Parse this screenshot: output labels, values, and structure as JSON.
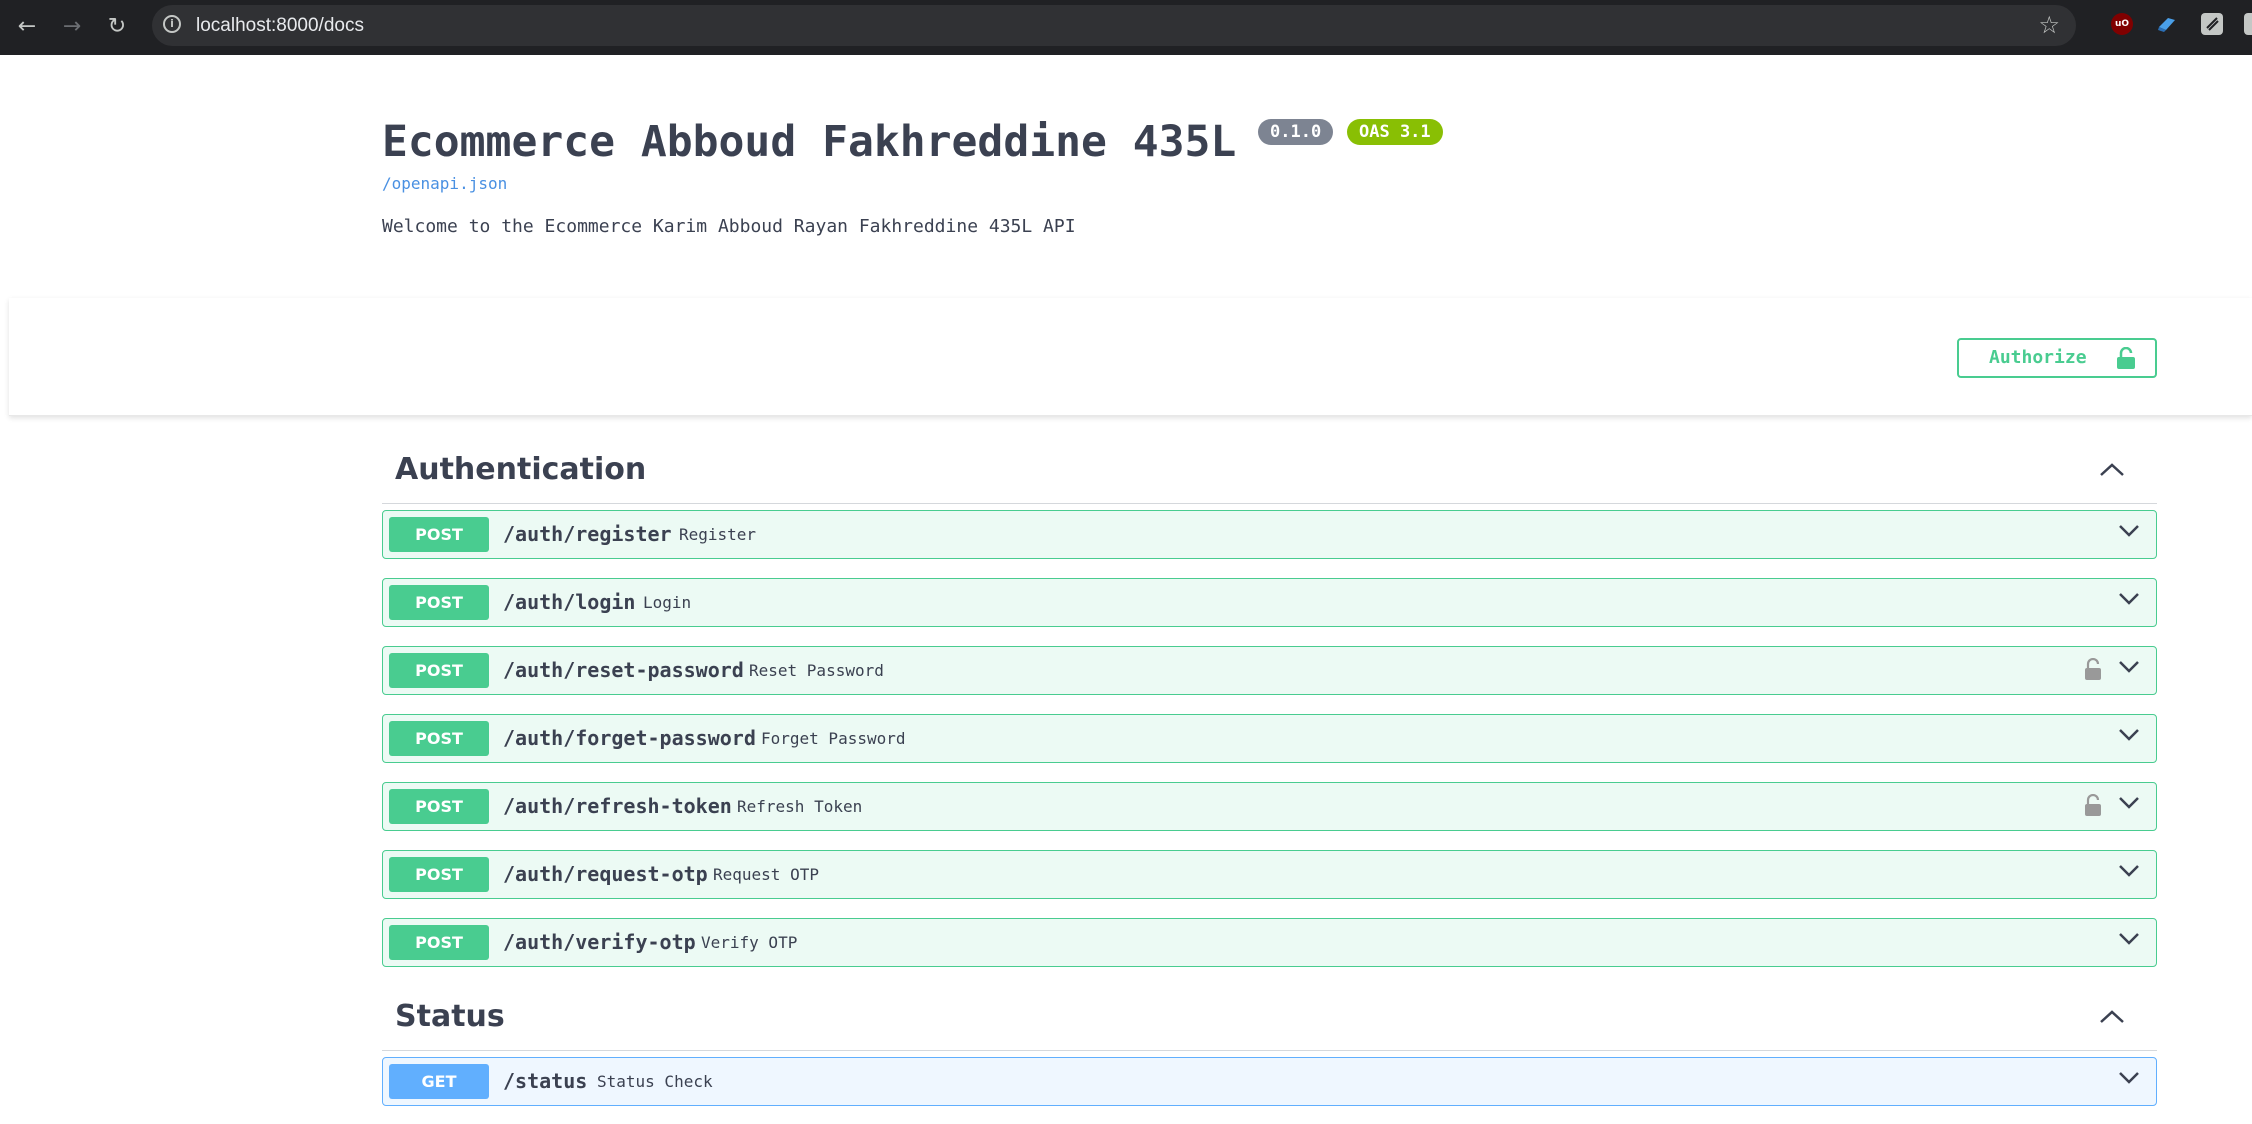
{
  "browser": {
    "url": "localhost:8000/docs",
    "back_icon": "arrow-left",
    "forward_icon": "arrow-right",
    "reload_icon": "reload",
    "bookmark_icon": "star",
    "extension_1_text": "uO"
  },
  "info": {
    "title": "Ecommerce Abboud Fakhreddine 435L",
    "version": "0.1.0",
    "oas": "OAS 3.1",
    "spec_link": "/openapi.json",
    "description": "Welcome to the Ecommerce Karim Abboud Rayan Fakhreddine 435L API"
  },
  "authorize": {
    "label": "Authorize"
  },
  "colors": {
    "post": "#49cc90",
    "get": "#61affe",
    "version_badge": "#7d8492",
    "oas_badge": "#89bf04"
  },
  "tags": [
    {
      "name": "Authentication",
      "operations": [
        {
          "method": "POST",
          "path": "/auth/register",
          "summary": "Register",
          "locked": false
        },
        {
          "method": "POST",
          "path": "/auth/login",
          "summary": "Login",
          "locked": false
        },
        {
          "method": "POST",
          "path": "/auth/reset-password",
          "summary": "Reset Password",
          "locked": true
        },
        {
          "method": "POST",
          "path": "/auth/forget-password",
          "summary": "Forget Password",
          "locked": false
        },
        {
          "method": "POST",
          "path": "/auth/refresh-token",
          "summary": "Refresh Token",
          "locked": true
        },
        {
          "method": "POST",
          "path": "/auth/request-otp",
          "summary": "Request OTP",
          "locked": false
        },
        {
          "method": "POST",
          "path": "/auth/verify-otp",
          "summary": "Verify OTP",
          "locked": false
        }
      ]
    },
    {
      "name": "Status",
      "operations": [
        {
          "method": "GET",
          "path": "/status",
          "summary": "Status Check",
          "locked": false
        }
      ]
    }
  ]
}
